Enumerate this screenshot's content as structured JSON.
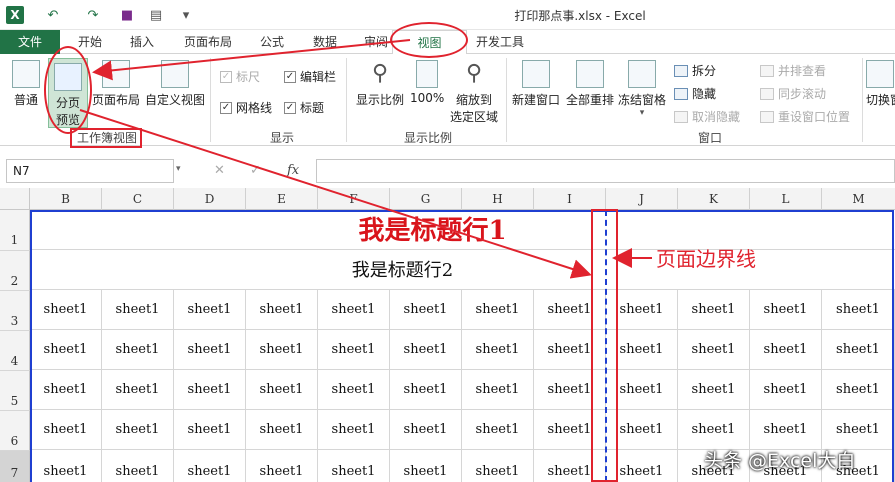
{
  "app": {
    "title": "打印那点事.xlsx - Excel",
    "logo": "X"
  },
  "quick_access": {
    "icons": [
      "undo-icon",
      "redo-icon",
      "save-icon",
      "print-preview-icon",
      "customize-icon"
    ]
  },
  "tabs": [
    "文件",
    "开始",
    "插入",
    "页面布局",
    "公式",
    "数据",
    "审阅",
    "视图",
    "开发工具"
  ],
  "ribbon": {
    "workbook_views": {
      "normal": "普通",
      "page_break_line1": "分页",
      "page_break_line2": "预览",
      "page_layout": "页面布局",
      "custom_views": "自定义视图",
      "label": "工作簿视图"
    },
    "show": {
      "ruler": "标尺",
      "formula_bar": "编辑栏",
      "gridlines": "网格线",
      "headings": "标题",
      "label": "显示"
    },
    "zoom": {
      "zoom": "显示比例",
      "hundred": "100%",
      "fit_line1": "缩放到",
      "fit_line2": "选定区域",
      "label": "显示比例"
    },
    "window": {
      "new_window": "新建窗口",
      "arrange_all": "全部重排",
      "freeze": "冻结窗格",
      "split": "拆分",
      "hide": "隐藏",
      "unhide": "取消隐藏",
      "side_by_side": "并排查看",
      "sync_scroll": "同步滚动",
      "reset_position": "重设窗口位置",
      "switch": "切换窗",
      "label": "窗口"
    }
  },
  "formula_bar": {
    "name_box": "N7",
    "fx": "fx",
    "cancel": "✕",
    "enter": "✓"
  },
  "sheet": {
    "columns": [
      "B",
      "C",
      "D",
      "E",
      "F",
      "G",
      "H",
      "I",
      "J",
      "K",
      "L",
      "M"
    ],
    "rows": [
      "1",
      "2",
      "3",
      "4",
      "5",
      "6",
      "7"
    ],
    "title1": "我是标题行1",
    "title2": "我是标题行2",
    "cell_text": "sheet1"
  },
  "annotations": {
    "boundary_label": "页面边界线"
  },
  "watermark": "头条 @Excel大白",
  "colors": {
    "accent": "#217346",
    "annotation": "#e0232e",
    "page_break": "#1f3fd1",
    "title1": "#d9141b"
  }
}
